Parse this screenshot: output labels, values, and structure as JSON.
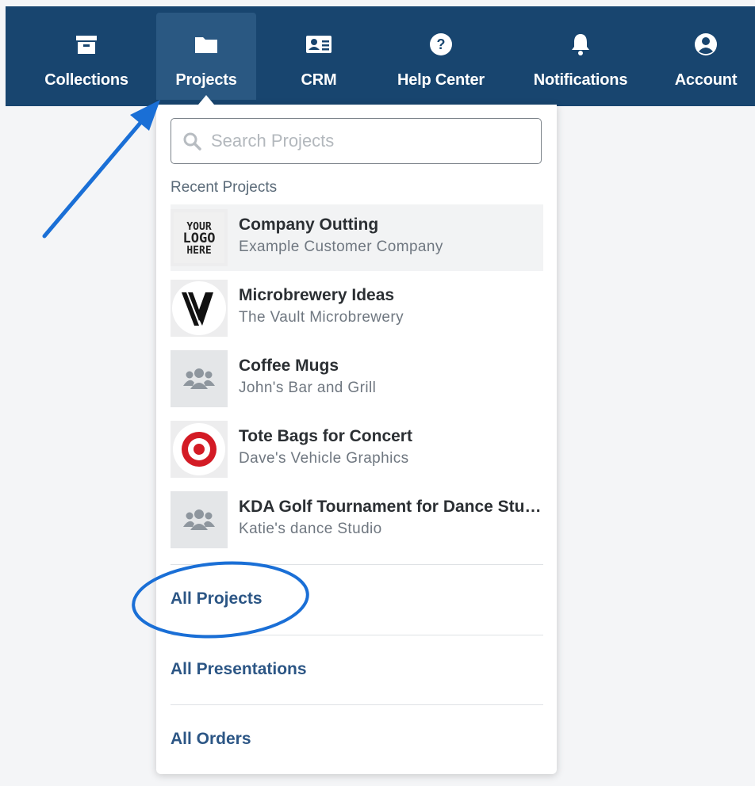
{
  "nav": {
    "items": [
      {
        "label": "Collections",
        "icon": "archive-box-icon"
      },
      {
        "label": "Projects",
        "icon": "folder-icon"
      },
      {
        "label": "CRM",
        "icon": "contact-card-icon"
      },
      {
        "label": "Help Center",
        "icon": "question-circle-icon"
      },
      {
        "label": "Notifications",
        "icon": "bell-icon"
      },
      {
        "label": "Account",
        "icon": "user-circle-icon"
      }
    ],
    "active": "Projects"
  },
  "dropdown": {
    "search_placeholder": "Search Projects",
    "search_value": "",
    "recent_label": "Recent Projects",
    "projects": [
      {
        "title": "Company Outting",
        "client": "Example Customer Company",
        "thumb": "logo-placeholder",
        "logo_text": "YOUR LOGO HERE"
      },
      {
        "title": "Microbrewery Ideas",
        "client": "The Vault Microbrewery",
        "thumb": "v-logo"
      },
      {
        "title": "Coffee Mugs",
        "client": "John's Bar and Grill",
        "thumb": "group-icon"
      },
      {
        "title": "Tote Bags for Concert",
        "client": "Dave's Vehicle Graphics",
        "thumb": "target-logo"
      },
      {
        "title": "KDA Golf Tournament for Dance Studio",
        "client": "Katie's dance Studio",
        "thumb": "group-icon"
      }
    ],
    "links": {
      "all_projects": "All Projects",
      "all_presentations": "All Presentations",
      "all_orders": "All Orders"
    }
  },
  "colors": {
    "nav_bg": "#18456f",
    "nav_active_bg": "#2a5882",
    "link": "#2c5685",
    "annotation": "#1a6fd6"
  }
}
